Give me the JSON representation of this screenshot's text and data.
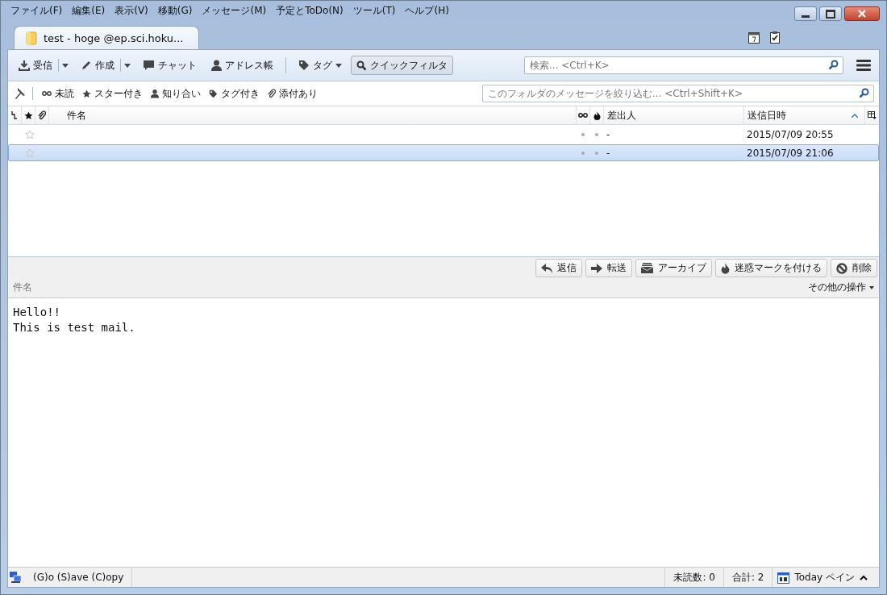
{
  "menu": [
    "ファイル(F)",
    "編集(E)",
    "表示(V)",
    "移動(G)",
    "メッセージ(M)",
    "予定とToDo(N)",
    "ツール(T)",
    "ヘルプ(H)"
  ],
  "tab": {
    "title": "test -  hoge @ep.sci.hoku...",
    "selected": true
  },
  "toolbar": [
    {
      "kind": "split",
      "label": "受信"
    },
    {
      "kind": "split",
      "label": "作成"
    },
    {
      "kind": "button",
      "label": "チャット"
    },
    {
      "kind": "button",
      "label": "アドレス帳"
    },
    {
      "kind": "separator"
    },
    {
      "kind": "dropdown",
      "label": "タグ"
    },
    {
      "kind": "toggle",
      "label": "クイックフィルタ",
      "on": true
    }
  ],
  "search": {
    "placeholder": "検索... <Ctrl+K>"
  },
  "filters": [
    {
      "label": "未読"
    },
    {
      "label": "スター付き"
    },
    {
      "label": "知り合い"
    },
    {
      "label": "タグ付き"
    },
    {
      "label": "添付あり"
    }
  ],
  "filter_search": {
    "placeholder": "このフォルダのメッセージを絞り込む... <Ctrl+Shift+K>"
  },
  "table": {
    "columns": [
      "件名",
      "差出人",
      "送信日時"
    ],
    "rows": [
      {
        "starred": false,
        "sender": "-",
        "date": "2015/07/09 20:55",
        "selected": false
      },
      {
        "starred": false,
        "sender": "-",
        "date": "2015/07/09 21:06",
        "selected": true
      }
    ]
  },
  "message": {
    "actions": [
      {
        "label": "返信"
      },
      {
        "label": "転送"
      },
      {
        "label": "アーカイブ"
      },
      {
        "label": "迷惑マークを付ける"
      },
      {
        "label": "削除"
      }
    ],
    "subject_label": "件名",
    "more": "その他の操作",
    "body": [
      "Hello!!",
      "This is test mail."
    ]
  },
  "status_bar": {
    "text": "(G)o (S)ave (C)opy",
    "unread": "未読数: 0",
    "total": "合計: 2",
    "today": "Today ペイン"
  }
}
